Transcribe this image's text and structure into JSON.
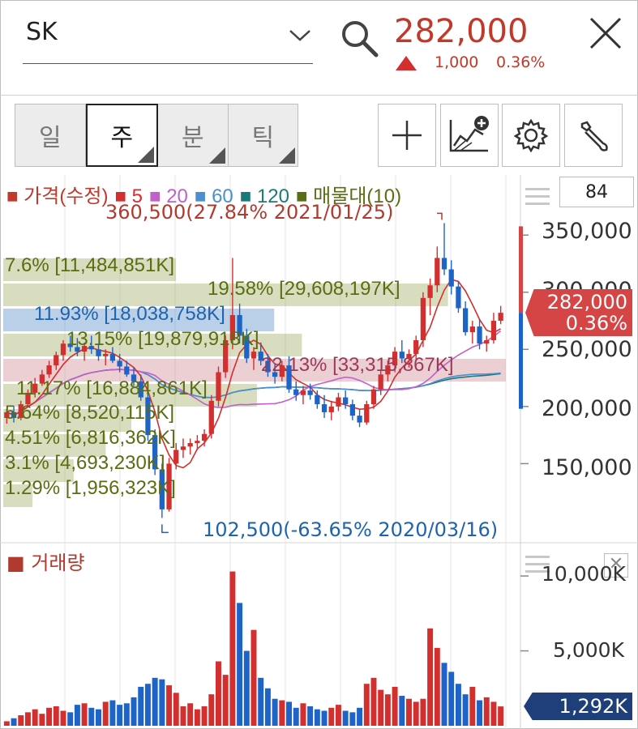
{
  "header": {
    "stock_name": "SK",
    "price": "282,000",
    "change": "1,000",
    "change_pct": "0.36%",
    "up_color": "#d32f2f"
  },
  "period_tabs": [
    {
      "label": "일",
      "active": false
    },
    {
      "label": "주",
      "active": true
    },
    {
      "label": "분",
      "active": false
    },
    {
      "label": "틱",
      "active": false
    }
  ],
  "toolbar": {
    "crosshair_icon": "crosshair-icon",
    "indicator_add_icon": "chart-add-icon",
    "settings_icon": "gear-icon",
    "tools_icon": "wrench-icon"
  },
  "legend": {
    "price": "가격(수정)",
    "ma5": "5",
    "ma20": "20",
    "ma60": "60",
    "ma120": "120",
    "volume_profile": "매물대(10)",
    "colors": {
      "price": "#c0392b",
      "ma5": "#d32f2f",
      "ma20": "#c060c8",
      "ma60": "#4a8fd0",
      "ma120": "#1a7a78",
      "vp": "#5a6d12"
    }
  },
  "indicator_count": "84",
  "high_marker": "360,500(27.84% 2021/01/25)",
  "low_marker": "102,500(-63.65% 2020/03/16)",
  "volume_profile": [
    {
      "label": "7.6% [11,484,851K]",
      "pct": 7.6
    },
    {
      "label": "19.58% [29,608,197K]",
      "pct": 19.58
    },
    {
      "label": "11.93% [18,038,758K]",
      "pct": 11.93
    },
    {
      "label": "13.15% [19,879,918K]",
      "pct": 13.15
    },
    {
      "label": "22.13% [33,315,867K]",
      "pct": 22.13
    },
    {
      "label": "11.17% [16,884,861K]",
      "pct": 11.17
    },
    {
      "label": "5.64% [8,520,115K]",
      "pct": 5.64
    },
    {
      "label": "4.51% [6,816,362K]",
      "pct": 4.51
    },
    {
      "label": "3.1% [4,693,230K]",
      "pct": 3.1
    },
    {
      "label": "1.29% [1,956,323K]",
      "pct": 1.29
    }
  ],
  "price_axis": [
    "350,000",
    "300,000",
    "250,000",
    "200,000",
    "150,000"
  ],
  "current_price_tag": {
    "price": "282,000",
    "pct": "0.36%"
  },
  "volume": {
    "legend": "거래량",
    "axis": [
      "10,000K",
      "5,000K"
    ],
    "current": "1,292K"
  },
  "chart_data": {
    "type": "candlestick",
    "title": "",
    "ylabel": "",
    "ylim": [
      95000,
      370000
    ],
    "high": 360500,
    "low": 102500,
    "last": 282000,
    "candles": [
      [
        190000,
        198000,
        185000,
        195000
      ],
      [
        195000,
        200000,
        186000,
        190000
      ],
      [
        190000,
        205000,
        188000,
        202000
      ],
      [
        202000,
        215000,
        200000,
        212000
      ],
      [
        212000,
        225000,
        208000,
        220000
      ],
      [
        220000,
        232000,
        218000,
        228000
      ],
      [
        228000,
        240000,
        225000,
        236000
      ],
      [
        236000,
        248000,
        232000,
        245000
      ],
      [
        245000,
        258000,
        240000,
        255000
      ],
      [
        255000,
        262000,
        248000,
        252000
      ],
      [
        252000,
        260000,
        244000,
        248000
      ],
      [
        248000,
        256000,
        240000,
        253000
      ],
      [
        253000,
        262000,
        246000,
        250000
      ],
      [
        250000,
        255000,
        240000,
        244000
      ],
      [
        244000,
        250000,
        236000,
        246000
      ],
      [
        246000,
        252000,
        238000,
        240000
      ],
      [
        240000,
        246000,
        230000,
        235000
      ],
      [
        235000,
        240000,
        226000,
        228000
      ],
      [
        228000,
        234000,
        218000,
        222000
      ],
      [
        222000,
        228000,
        205000,
        208000
      ],
      [
        208000,
        212000,
        170000,
        175000
      ],
      [
        175000,
        180000,
        140000,
        145000
      ],
      [
        145000,
        150000,
        102500,
        110000
      ],
      [
        110000,
        155000,
        108000,
        150000
      ],
      [
        150000,
        168000,
        145000,
        162000
      ],
      [
        162000,
        172000,
        155000,
        165000
      ],
      [
        165000,
        172000,
        158000,
        168000
      ],
      [
        168000,
        175000,
        162000,
        170000
      ],
      [
        170000,
        180000,
        165000,
        176000
      ],
      [
        176000,
        210000,
        172000,
        205000
      ],
      [
        205000,
        235000,
        200000,
        230000
      ],
      [
        230000,
        262000,
        225000,
        258000
      ],
      [
        258000,
        330000,
        250000,
        280000
      ],
      [
        280000,
        290000,
        255000,
        262000
      ],
      [
        262000,
        268000,
        238000,
        242000
      ],
      [
        242000,
        252000,
        232000,
        248000
      ],
      [
        248000,
        256000,
        236000,
        240000
      ],
      [
        240000,
        246000,
        226000,
        230000
      ],
      [
        230000,
        238000,
        220000,
        226000
      ],
      [
        226000,
        240000,
        222000,
        236000
      ],
      [
        236000,
        244000,
        212000,
        215000
      ],
      [
        215000,
        222000,
        205000,
        210000
      ],
      [
        210000,
        218000,
        202000,
        214000
      ],
      [
        214000,
        220000,
        206000,
        210000
      ],
      [
        210000,
        214000,
        198000,
        202000
      ],
      [
        202000,
        210000,
        190000,
        195000
      ],
      [
        195000,
        205000,
        188000,
        200000
      ],
      [
        200000,
        212000,
        196000,
        208000
      ],
      [
        208000,
        214000,
        198000,
        202000
      ],
      [
        202000,
        206000,
        188000,
        192000
      ],
      [
        192000,
        198000,
        182000,
        186000
      ],
      [
        186000,
        205000,
        184000,
        202000
      ],
      [
        202000,
        218000,
        198000,
        215000
      ],
      [
        215000,
        232000,
        210000,
        228000
      ],
      [
        228000,
        240000,
        222000,
        236000
      ],
      [
        236000,
        252000,
        230000,
        248000
      ],
      [
        248000,
        258000,
        238000,
        242000
      ],
      [
        242000,
        250000,
        234000,
        246000
      ],
      [
        246000,
        262000,
        240000,
        258000
      ],
      [
        258000,
        300000,
        252000,
        295000
      ],
      [
        295000,
        312000,
        280000,
        306000
      ],
      [
        306000,
        340000,
        300000,
        330000
      ],
      [
        330000,
        360500,
        315000,
        320000
      ],
      [
        320000,
        328000,
        298000,
        305000
      ],
      [
        305000,
        310000,
        282000,
        286000
      ],
      [
        286000,
        292000,
        262000,
        265000
      ],
      [
        265000,
        275000,
        255000,
        270000
      ],
      [
        270000,
        276000,
        250000,
        255000
      ],
      [
        255000,
        262000,
        248000,
        258000
      ],
      [
        258000,
        282000,
        255000,
        275000
      ],
      [
        275000,
        288000,
        272000,
        282000
      ]
    ],
    "volumes_k": [
      300,
      500,
      700,
      900,
      1100,
      800,
      1200,
      1300,
      1000,
      900,
      1400,
      1500,
      1200,
      1100,
      1600,
      1700,
      1400,
      1500,
      1900,
      2600,
      2800,
      3200,
      3100,
      2700,
      2200,
      1300,
      1500,
      1100,
      1300,
      2100,
      4300,
      3400,
      10300,
      8200,
      5000,
      6400,
      3200,
      2500,
      1800,
      1700,
      1600,
      1200,
      1500,
      1300,
      1100,
      1000,
      1200,
      1400,
      1000,
      900,
      1200,
      2800,
      3200,
      2400,
      2100,
      2600,
      2000,
      1800,
      1600,
      1800,
      6500,
      5200,
      4200,
      3600,
      2800,
      2100,
      2600,
      1700,
      1900,
      1600,
      1292
    ]
  }
}
